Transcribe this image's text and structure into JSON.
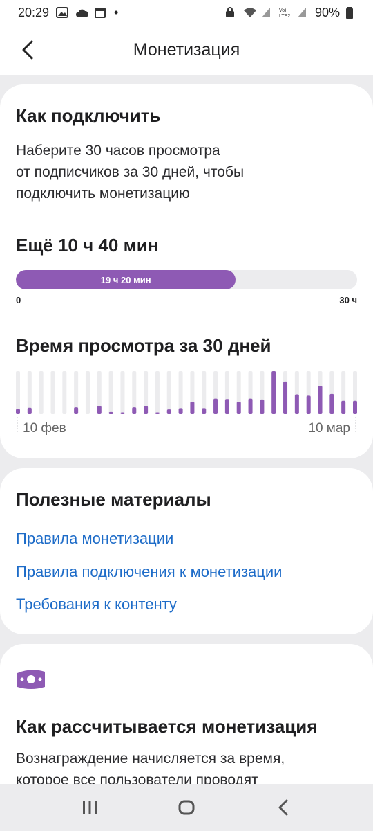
{
  "status_bar": {
    "time": "20:29",
    "battery": "90%",
    "icons": [
      "image-icon",
      "cloud-icon",
      "calendar-icon",
      "dot-icon",
      "lock-icon",
      "wifi-icon",
      "volte-icon",
      "signal-icon",
      "battery-icon"
    ]
  },
  "header": {
    "title": "Монетизация",
    "back_icon": "chevron-left-icon"
  },
  "how_to_connect": {
    "title": "Как подключить",
    "line1": "Наберите 30 часов просмотра",
    "line2": "от подписчиков за 30 дней, чтобы",
    "line3": "подключить монетизацию",
    "remaining": "Ещё 10 ч 40 мин",
    "progress": {
      "label": "19 ч 20 мин",
      "value_hours": 19.333,
      "max_hours": 30,
      "min_label": "0",
      "max_label": "30 ч"
    }
  },
  "watch_time": {
    "title": "Время просмотра за 30 дней"
  },
  "chart_data": {
    "type": "bar",
    "title": "Время просмотра за 30 дней",
    "tick_labels": [
      "10 фев",
      "10 мар"
    ],
    "values": [
      0.12,
      0.15,
      0.0,
      0.0,
      0.0,
      0.16,
      0.0,
      0.19,
      0.05,
      0.04,
      0.16,
      0.19,
      0.04,
      0.11,
      0.14,
      0.29,
      0.14,
      0.36,
      0.35,
      0.29,
      0.36,
      0.34,
      1.0,
      0.76,
      0.46,
      0.43,
      0.66,
      0.47,
      0.31,
      0.31
    ],
    "max_value": 1.0,
    "colors": {
      "bar": "#8e5ab4",
      "track": "#ececee"
    }
  },
  "useful": {
    "title": "Полезные материалы",
    "links": [
      "Правила монетизации",
      "Правила подключения к монетизации",
      "Требования к контенту"
    ]
  },
  "how_calculated": {
    "icon": "money-icon",
    "title": "Как рассчитывается монетизация",
    "line1": "Вознаграждение начисляется за время,",
    "line2": "которое все пользователи проводят"
  },
  "nav": {
    "icons": [
      "recent-apps-icon",
      "home-icon",
      "back-icon"
    ]
  },
  "colors": {
    "accent": "#8e5ab4",
    "link": "#1e6cc8",
    "background": "#ececee"
  }
}
